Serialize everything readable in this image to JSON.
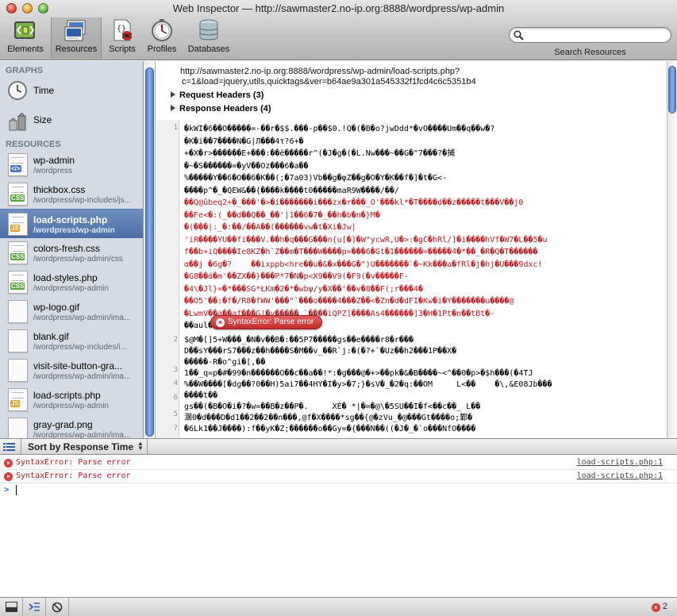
{
  "window": {
    "title": "Web Inspector — http://sawmaster2.no-ip.org:8888/wordpress/wp-admin"
  },
  "toolbar": {
    "items": [
      {
        "label": "Elements",
        "icon": "elements-icon"
      },
      {
        "label": "Resources",
        "icon": "resources-icon",
        "selected": true
      },
      {
        "label": "Scripts",
        "icon": "scripts-icon"
      },
      {
        "label": "Profiles",
        "icon": "profiles-icon"
      },
      {
        "label": "Databases",
        "icon": "databases-icon"
      }
    ],
    "search": {
      "label": "Search Resources",
      "value": "",
      "placeholder": ""
    }
  },
  "sidebar": {
    "graphs_header": "GRAPHS",
    "graphs": [
      {
        "label": "Time"
      },
      {
        "label": "Size"
      }
    ],
    "resources_header": "RESOURCES",
    "resources": [
      {
        "name": "wp-admin",
        "path": "/wordpress",
        "type": "doc"
      },
      {
        "name": "thickbox.css",
        "path": "/wordpress/wp-includes/js...",
        "type": "css"
      },
      {
        "name": "load-scripts.php",
        "path": "/wordpress/wp-admin",
        "type": "js",
        "selected": true
      },
      {
        "name": "colors-fresh.css",
        "path": "/wordpress/wp-admin/css",
        "type": "css"
      },
      {
        "name": "load-styles.php",
        "path": "/wordpress/wp-admin",
        "type": "css"
      },
      {
        "name": "wp-logo.gif",
        "path": "/wordpress/wp-admin/ima...",
        "type": "img"
      },
      {
        "name": "blank.gif",
        "path": "/wordpress/wp-includes/i...",
        "type": "img"
      },
      {
        "name": "visit-site-button-gra...",
        "path": "/wordpress/wp-admin/ima...",
        "type": "img"
      },
      {
        "name": "load-scripts.php",
        "path": "/wordpress/wp-admin",
        "type": "js"
      },
      {
        "name": "gray-grad.png",
        "path": "/wordpress/wp-admin/ima...",
        "type": "img"
      }
    ]
  },
  "resource_view": {
    "url_line1": "http://sawmaster2.no-ip.org:8888/wordpress/wp-admin/load-scripts.php?",
    "url_line2": "c=1&load=jquery,utils,quicktags&ver=b64ae9a301a545332f1fcd4c6c5351b4",
    "request_headers": "Request Headers (3)",
    "response_headers": "Response Headers (4)",
    "error_bubble": "SyntaxError: Parse error",
    "line_numbers": {
      "l1": "1",
      "l2": "2",
      "l3": "3",
      "l4": "4",
      "l5": "5",
      "l6": "6",
      "l7": "7"
    },
    "code_lines": [
      "�kWI�6��O�����=-��r�$$.���-p��$0.!Q�(�B�o?jwDdd*�vO����Um��q��w�?",
      "�K�i��7����N�G|Л���4τ?6+�",
      "+�X�r>������E+���:��ë�����r^(�J�g�(�L.Nw���~��G�\"7���?�捕",
      "�~�S������=�yV��Oz���6�a��",
      "%�����Y��6�O��6�K��(;�7a03)Vb��g�φZ��g�O�Y�K��f�]�t�G<-",
      "����p^�_�QEW&��{����k����t0�����maR9W����/��/",
      "��Q@ûbeq2+�_���'�>�i�������i���zx�r���_O'���kl*�T����d��z�����t���V��j0",
      "��Fe<�:(_��d��Q��_��'|1��6�7�_��h�b�n�}M�",
      "�(���|:_�:��/��A��(������vw�t�Xi�Jw|",
      "'iR����YU��fi���V.��h�q���G���n{u[�]�W\"ycwR,U�>:�gC�hRl/]�i����hVf�W7�L��5�u",
      "f��b+iQ����Ie8KZ�h`Z��m�T���W����p=���6�Gt�1������=�����4�*��_�R�Q�T������",
      "α��j �6g�?    ��ixppb<hre��u�&�x���G�\")U�������`�~Kk���a�fRl�j�hj�U���9dxc!",
      "�G8��ά�m'��ZX��}���P*7�N�p<X9��V9(�F9(�v�����F-",
      "�4\\�Jl}=�*���SG*ŁKm�2�*�wbψ/y�X��'��v�8��F(;r���4�       ",
      "��O5'��:�f�/R8�fWW'���\"`���o����4���Z��<�Zn�d�dFI�Kw�i�Y�������u����@",
      "�LwmV��a��af���G|�v����� `����iQPZ]����As4������]3�H�1Pt�n��tBt�-",
      "��aul�l�Oz����J4��njpu=�"
    ],
    "code_lines_2": [
      "$@M�[]5+W���_�N�v��B�:��5P7�����gs��e����r8�r���",
      "D��sY���rS7���z��h����S�M��v_��R`j:�(�?+`�Uz��h2���1P��X�",
      "�����-R�o^gi�[,��",
      "1��_q=p�#�99�n������O��c��a��!*:�g���@�+>��pk�&�B����~<^��0�p>�$h���(�4TJ",
      "%��W����[�dg��?0��H)5ai7��4HY�I�y>�7;}�sV�_�2�q:��OM     L<��    �\\,&E08Jb���",
      "����t��",
      "gs��(�B�O�i�?�w=��B�z��P�.     XÈ� *|�=�@\\�5SU��I�f<��c��_ L��",
      "溷0�d���D�d1��2��2��n���,@f�X����*sg��{@�zVu_�@���Gt����o;鄴�",
      "�6Lk1��J����):f��yK�Z;������o��Gy=�{���N��((�J�_�`o���NfO����"
    ]
  },
  "sortbar": {
    "label": "Sort by Response Time"
  },
  "console": {
    "messages": [
      {
        "text": "SyntaxError: Parse error",
        "source": "load-scripts.php:1"
      },
      {
        "text": "SyntaxError: Parse error",
        "source": "load-scripts.php:1"
      }
    ],
    "prompt": ">"
  },
  "statusbar": {
    "error_count": "2"
  },
  "colors": {
    "selection": "#4b6fa6",
    "error": "#c4191c",
    "sidebar_bg": "#d4dbe4"
  }
}
